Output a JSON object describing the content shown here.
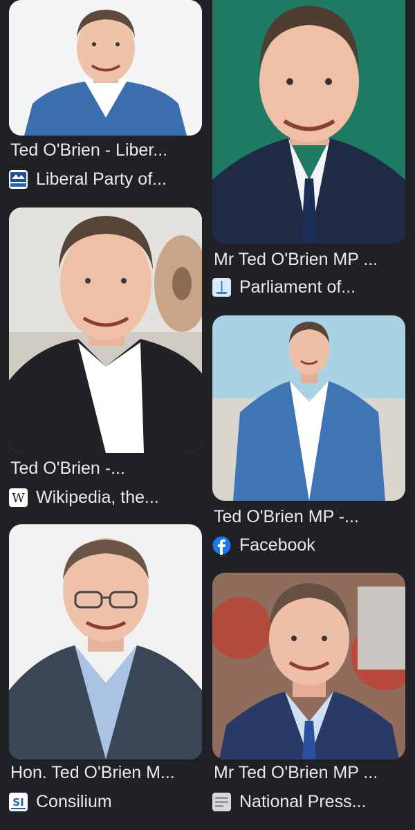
{
  "results": [
    {
      "title": "Ted O'Brien - Liber...",
      "source": "Liberal Party of...",
      "favicon": "liberal-party-favicon",
      "bg": "#f2f3f5",
      "jacket": "#3b6fb0"
    },
    {
      "title": "Mr Ted O'Brien MP ...",
      "source": "Parliament of...",
      "favicon": "parliament-favicon",
      "bg": "#1f7a64",
      "jacket": "#1f2b45"
    },
    {
      "title": "Ted O'Brien -...",
      "source": "Wikipedia, the...",
      "favicon": "wikipedia-w-icon",
      "bg": "#d9d6cf",
      "jacket": "#202226"
    },
    {
      "title": "Ted O'Brien MP -...",
      "source": "Facebook",
      "favicon": "facebook-f-icon",
      "bg": "#9fc6d8",
      "jacket": "#3f75b5"
    },
    {
      "title": "Hon. Ted O'Brien M...",
      "source": "Consilium",
      "favicon": "consilium-si-icon",
      "bg": "#f1f1f1",
      "jacket": "#3a4656"
    },
    {
      "title": "Mr Ted O'Brien MP ...",
      "source": "National Press...",
      "favicon": "national-press-favicon",
      "bg": "#a26d5d",
      "jacket": "#2a3a66"
    }
  ]
}
